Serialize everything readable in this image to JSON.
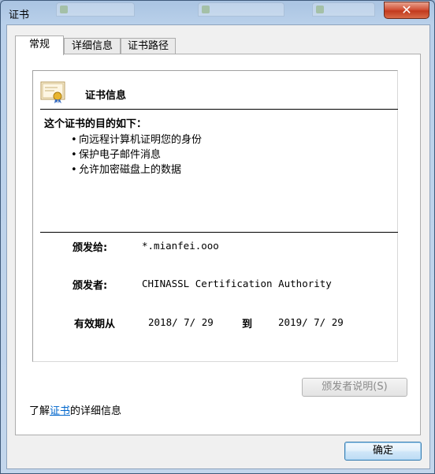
{
  "window": {
    "title": "证书",
    "close_glyph": "✕"
  },
  "background_tabs": [
    "",
    "",
    ""
  ],
  "tabs": [
    {
      "label": "常规"
    },
    {
      "label": "详细信息"
    },
    {
      "label": "证书路径"
    }
  ],
  "cert": {
    "icon": "certificate-icon",
    "header": "证书信息",
    "purpose_title": "这个证书的目的如下：",
    "purposes": [
      "向远程计算机证明您的身份",
      "保护电子邮件消息",
      "允许加密磁盘上的数据"
    ],
    "issued_to_label": "颁发给:",
    "issued_to": "*.mianfei.ooo",
    "issued_by_label": "颁发者:",
    "issued_by": "CHINASSL Certification Authority",
    "validity_label": "有效期从",
    "valid_from": "2018/ 7/ 29",
    "to_label": "到",
    "valid_to": "2019/ 7/ 29"
  },
  "issuer_statement_button": "颁发者说明(S)",
  "learn_more": {
    "prefix": "了解",
    "link": "证书",
    "suffix": "的详细信息"
  },
  "ok_button": "确定",
  "colors": {
    "link": "#0066cc",
    "close_button": "#c23a1e",
    "title_bar": "#b9d0ea"
  }
}
